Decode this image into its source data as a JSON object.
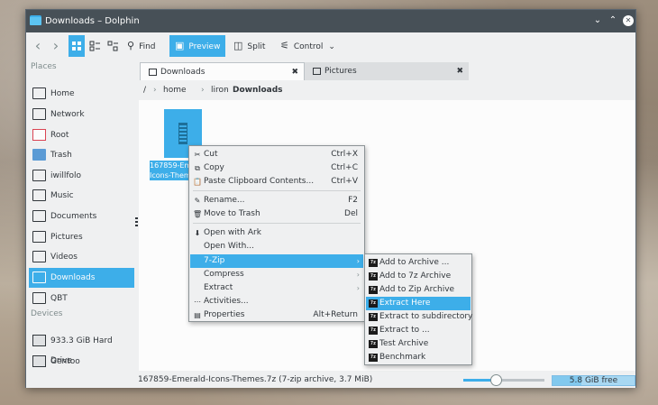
{
  "window": {
    "title": "Downloads – Dolphin"
  },
  "titlebar_buttons": {
    "minimize": "⌄",
    "maximize": "⌃",
    "close": "✕"
  },
  "toolbar": {
    "back": "‹",
    "forward": "›",
    "find": "Find",
    "preview": "Preview",
    "split": "Split",
    "control": "Control"
  },
  "sidebar": {
    "places_title": "Places",
    "places": [
      {
        "label": "Home",
        "icon": "home-icon"
      },
      {
        "label": "Network",
        "icon": "network-icon"
      },
      {
        "label": "Root",
        "icon": "root-folder-icon"
      },
      {
        "label": "Trash",
        "icon": "trash-icon"
      },
      {
        "label": "iwillfolo",
        "icon": "folder-icon"
      },
      {
        "label": "Music",
        "icon": "music-icon"
      },
      {
        "label": "Documents",
        "icon": "documents-icon"
      },
      {
        "label": "Pictures",
        "icon": "pictures-icon"
      },
      {
        "label": "Videos",
        "icon": "videos-icon"
      },
      {
        "label": "Downloads",
        "icon": "downloads-icon",
        "selected": true
      },
      {
        "label": "QBT",
        "icon": "folder-icon"
      }
    ],
    "devices_title": "Devices",
    "devices": [
      {
        "label": "933.3 GiB Hard Drive",
        "icon": "harddrive-icon"
      },
      {
        "label": "Gentoo",
        "icon": "harddrive-icon"
      }
    ]
  },
  "tabs": [
    {
      "label": "Downloads",
      "active": true,
      "close": "✖"
    },
    {
      "label": "Pictures",
      "active": false,
      "close": "✖"
    }
  ],
  "breadcrumb": {
    "root": "/",
    "parts": [
      "home",
      "liron",
      "Downloads"
    ]
  },
  "file": {
    "name_line1": "167859-Emerald-",
    "name_line2": "Icons-Themes.7z"
  },
  "context_menu": {
    "items": [
      {
        "icon": "✂",
        "label": "Cut",
        "shortcut": "Ctrl+X"
      },
      {
        "icon": "⧉",
        "label": "Copy",
        "shortcut": "Ctrl+C"
      },
      {
        "icon": "📋",
        "label": "Paste Clipboard Contents...",
        "shortcut": "Ctrl+V"
      },
      {
        "icon": "✎",
        "label": "Rename...",
        "shortcut": "F2"
      },
      {
        "icon": "🗑",
        "label": "Move to Trash",
        "shortcut": "Del"
      },
      {
        "icon": "⬇",
        "label": "Open with Ark",
        "shortcut": ""
      },
      {
        "icon": "",
        "label": "Open With...",
        "shortcut": ""
      },
      {
        "icon": "",
        "label": "7-Zip",
        "shortcut": ""
      },
      {
        "icon": "",
        "label": "Compress",
        "shortcut": ""
      },
      {
        "icon": "",
        "label": "Extract",
        "shortcut": ""
      },
      {
        "icon": "⋯",
        "label": "Activities...",
        "shortcut": ""
      },
      {
        "icon": "▤",
        "label": "Properties",
        "shortcut": "Alt+Return"
      }
    ],
    "submenu_arrow": "›"
  },
  "submenu_7zip": {
    "icon_text": "7z",
    "items": [
      "Add to Archive ...",
      "Add to 7z Archive",
      "Add to Zip Archive",
      "Extract Here",
      "Extract to subdirectory",
      "Extract to ...",
      "Test Archive",
      "Benchmark"
    ]
  },
  "statusbar": {
    "text": "167859-Emerald-Icons-Themes.7z (7-zip archive, 3.7 MiB)",
    "zoom_level": 0.4,
    "free_space": "5.8 GiB free",
    "free_fraction": 0.35
  }
}
